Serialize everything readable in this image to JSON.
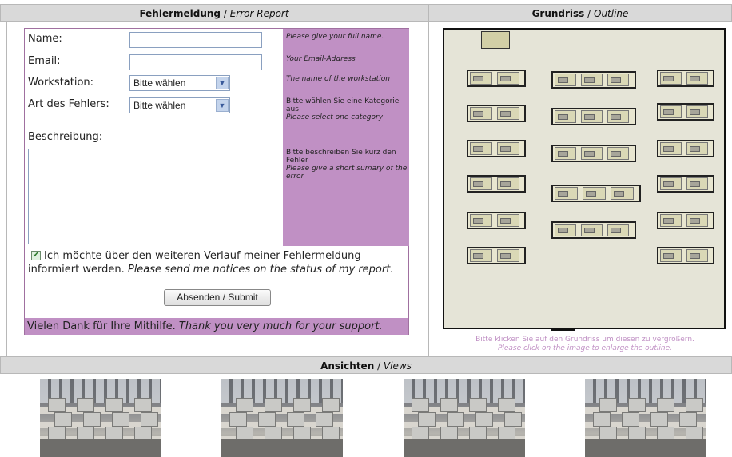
{
  "form_header": {
    "title": "Fehlermeldung",
    "subtitle": "Error Report"
  },
  "outline_header": {
    "title": "Grundriss",
    "subtitle": "Outline"
  },
  "views_header": {
    "title": "Ansichten",
    "subtitle": "Views"
  },
  "form": {
    "name_label": "Name:",
    "name_help": "Please give your full name.",
    "email_label": "Email:",
    "email_help": "Your Email-Address",
    "workstation_label": "Workstation:",
    "workstation_value": "Bitte wählen",
    "workstation_help": "The name of the workstation",
    "error_type_label": "Art des Fehlers:",
    "error_type_value": "Bitte wählen",
    "error_type_help_de": "Bitte wählen Sie eine Kategorie aus",
    "error_type_help_en": "Please select one category",
    "description_label": "Beschreibung:",
    "description_help_de": "Bitte beschreiben Sie kurz den Fehler",
    "description_help_en": "Please give a short sumary of the error",
    "notify_checked": true,
    "notify_de": "Ich möchte über den weiteren Verlauf meiner Fehlermeldung informiert werden.",
    "notify_en": "Please send me notices on the status of my report.",
    "submit_label": "Absenden / Submit",
    "thanks_de": "Vielen Dank für Ihre Mithilfe.",
    "thanks_en": "Thank you very much for your support."
  },
  "outline": {
    "caption_de": "Bitte klicken Sie auf den Grundriss um diesen zu vergrößern.",
    "caption_en": "Please click on the image to enlarge the outline."
  },
  "views": {
    "photos": [
      "classroom-photo-1",
      "classroom-photo-2",
      "classroom-photo-3",
      "classroom-photo-4"
    ]
  },
  "colors": {
    "accent": "#c090c4",
    "header_bg": "#d9d9d9",
    "outline_bg": "#e5e4d7"
  }
}
